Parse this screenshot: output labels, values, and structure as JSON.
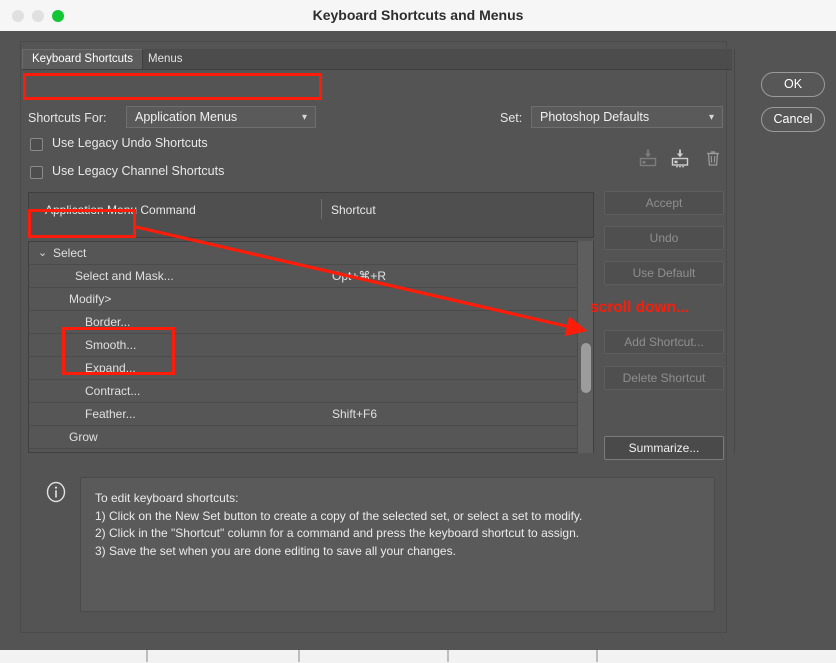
{
  "window": {
    "title": "Keyboard Shortcuts and Menus",
    "traffic_lights": [
      "close",
      "minimize",
      "maximize"
    ]
  },
  "tabs": [
    {
      "label": "Keyboard Shortcuts",
      "active": true
    },
    {
      "label": "Menus",
      "active": false
    }
  ],
  "fields": {
    "shortcuts_for_label": "Shortcuts For:",
    "shortcuts_for_value": "Application Menus",
    "set_label": "Set:",
    "set_value": "Photoshop Defaults"
  },
  "checkboxes": [
    {
      "label": "Use Legacy Undo Shortcuts",
      "checked": false
    },
    {
      "label": "Use Legacy Channel Shortcuts",
      "checked": false
    }
  ],
  "set_icons": [
    {
      "name": "new-set-icon"
    },
    {
      "name": "save-set-icon"
    },
    {
      "name": "delete-set-icon"
    }
  ],
  "table": {
    "headers": {
      "command": "Application Menu Command",
      "shortcut": "Shortcut"
    },
    "rows": [
      {
        "label": "Select",
        "shortcut": "",
        "indent": 0,
        "disclosure": "⌄"
      },
      {
        "label": "Select and Mask...",
        "shortcut": "Opt+⌘+R",
        "indent": 1,
        "disclosure": ""
      },
      {
        "label": "Modify>",
        "shortcut": "",
        "indent": 1,
        "disclosure": ""
      },
      {
        "label": "Border...",
        "shortcut": "",
        "indent": 2,
        "disclosure": ""
      },
      {
        "label": "Smooth...",
        "shortcut": "",
        "indent": 2,
        "disclosure": ""
      },
      {
        "label": "Expand...",
        "shortcut": "",
        "indent": 2,
        "disclosure": ""
      },
      {
        "label": "Contract...",
        "shortcut": "",
        "indent": 2,
        "disclosure": ""
      },
      {
        "label": "Feather...",
        "shortcut": "Shift+F6",
        "indent": 2,
        "disclosure": ""
      },
      {
        "label": "Grow",
        "shortcut": "",
        "indent": 1,
        "disclosure": ""
      }
    ]
  },
  "side_buttons": [
    {
      "label": "Accept",
      "enabled": false
    },
    {
      "label": "Undo",
      "enabled": false
    },
    {
      "label": "Use Default",
      "enabled": false
    },
    {
      "label": "Add Shortcut...",
      "enabled": false
    },
    {
      "label": "Delete Shortcut",
      "enabled": false
    },
    {
      "label": "Summarize...",
      "enabled": true
    }
  ],
  "dialog_buttons": {
    "ok": "OK",
    "cancel": "Cancel"
  },
  "info": {
    "lines": [
      "To edit keyboard shortcuts:",
      "1) Click on the New Set button to create a copy of the selected set, or select a set to modify.",
      "2) Click in the \"Shortcut\" column for a command and press the keyboard shortcut to assign.",
      "3) Save the set when you are done editing to save all your changes."
    ]
  },
  "annotations": {
    "color": "#fc1c0a",
    "scroll_text": "scroll down...",
    "boxes": [
      "shortcuts-for-row",
      "select-row",
      "expand-contract-rows"
    ],
    "arrow": {
      "from": "select-row",
      "to": "list-scrollbar-thumb"
    }
  }
}
